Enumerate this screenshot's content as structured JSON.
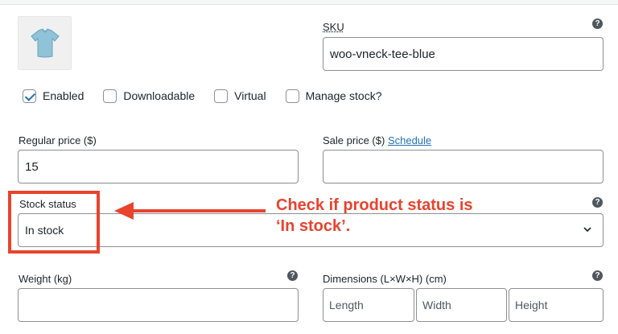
{
  "sku": {
    "label": "SKU",
    "value": "woo-vneck-tee-blue"
  },
  "options": [
    {
      "label": "Enabled",
      "checked": true
    },
    {
      "label": "Downloadable",
      "checked": false
    },
    {
      "label": "Virtual",
      "checked": false
    },
    {
      "label": "Manage stock?",
      "checked": false
    }
  ],
  "regular_price": {
    "label": "Regular price ($)",
    "value": "15"
  },
  "sale_price": {
    "label": "Sale price ($)",
    "schedule_link": "Schedule",
    "value": ""
  },
  "stock_status": {
    "label": "Stock status",
    "value": "In stock"
  },
  "weight": {
    "label": "Weight (kg)",
    "value": ""
  },
  "dimensions": {
    "label": "Dimensions (L×W×H) (cm)",
    "length_placeholder": "Length",
    "width_placeholder": "Width",
    "height_placeholder": "Height"
  },
  "help_glyph": "?",
  "annotation": {
    "text": "Check if product status is\n‘In stock’.",
    "color": "#e8432d"
  }
}
